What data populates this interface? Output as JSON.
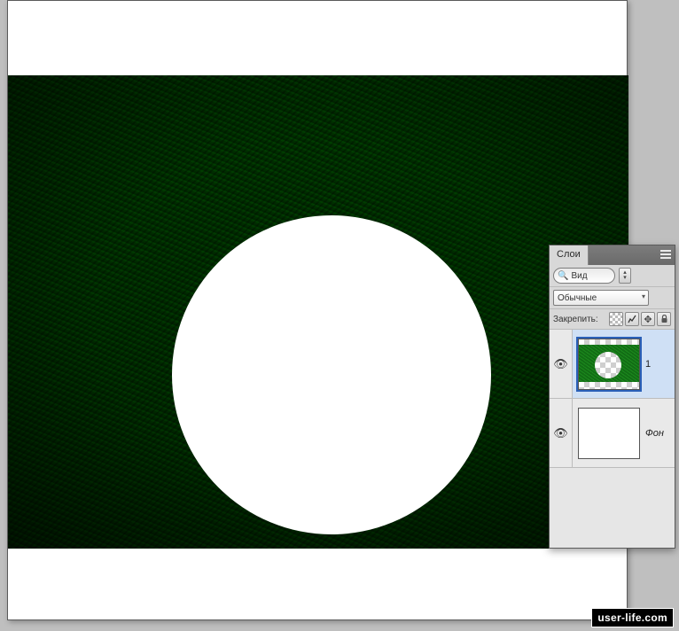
{
  "panel": {
    "tabs": {
      "main": "Слои"
    },
    "search": {
      "placeholder": "Вид"
    },
    "blend_mode": "Обычные",
    "lock_label": "Закрепить:",
    "lock_icons": {
      "transparency": "transparency-lock-icon",
      "paint": "brush-icon",
      "move": "move-icon",
      "all": "lock-icon"
    }
  },
  "layers": [
    {
      "name": "1",
      "visible": true,
      "selected": true,
      "has_mask": false
    },
    {
      "name": "Фон",
      "visible": true,
      "selected": false,
      "has_mask": false
    }
  ],
  "watermark": "user-life.com"
}
